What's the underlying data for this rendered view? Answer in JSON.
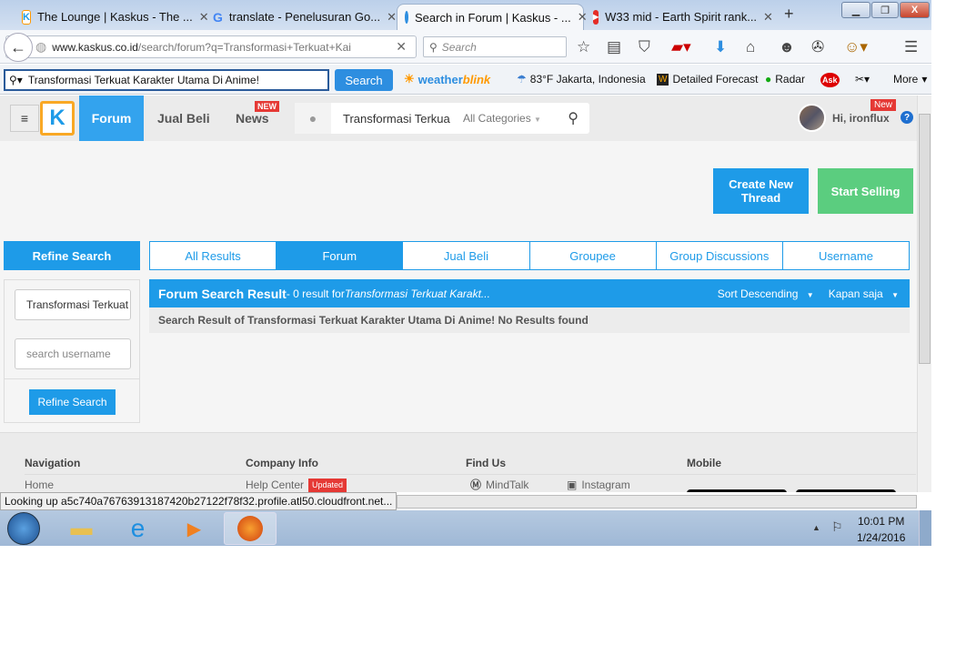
{
  "browser": {
    "tabs": [
      {
        "title": "The Lounge | Kaskus - The ...",
        "icon": "kaskus-icon"
      },
      {
        "title": "translate - Penelusuran Go...",
        "icon": "google-icon"
      },
      {
        "title": "Search in Forum | Kaskus - ...",
        "icon": "loading-icon",
        "active": true
      },
      {
        "title": "W33 mid - Earth Spirit rank...",
        "icon": "youtube-icon"
      }
    ],
    "new_tab": "+",
    "url_domain": "www.kaskus.co.id",
    "url_path": "/search/forum?q=Transformasi+Terkuat+Kai",
    "search_placeholder": "Search",
    "status": "Looking up a5c740a76763913187420b27122f78f32.profile.atl50.cloudfront.net..."
  },
  "toolbar": {
    "search_value": "Transformasi Terkuat Karakter Utama Di Anime!",
    "search_button": "Search",
    "weather_brand": "weather",
    "weather_brand2": "blink",
    "weather": "83°F Jakarta, Indonesia",
    "forecast": "Detailed Forecast",
    "radar": "Radar",
    "more": "More"
  },
  "header": {
    "nav": [
      "Forum",
      "Jual Beli",
      "News"
    ],
    "news_badge": "NEW",
    "search_value": "Transformasi Terkua",
    "category": "All Categories",
    "user": "Hi, ironflux",
    "user_badge": "New",
    "help": "?"
  },
  "actions": {
    "create": "Create New Thread",
    "sell": "Start Selling"
  },
  "refine": {
    "title": "Refine Search",
    "query": "Transformasi Terkuat Karakter Utama Di Anime!",
    "username_placeholder": "search username",
    "button": "Refine Search"
  },
  "search_tabs": [
    "All Results",
    "Forum",
    "Jual Beli",
    "Groupee",
    "Group Discussions",
    "Username"
  ],
  "results": {
    "title": "Forum Search Result",
    "count_text": " - 0 result for ",
    "query": "Transformasi Terkuat Karakt...",
    "sort": "Sort Descending",
    "time": "Kapan saja",
    "message": "Search Result of Transformasi Terkuat Karakter Utama Di Anime! No Results found"
  },
  "footer": {
    "columns": [
      "Navigation",
      "Company Info",
      "Find Us",
      "Mobile"
    ],
    "home": "Home",
    "help_center": "Help Center",
    "updated": "Updated",
    "mindtalk": "MindTalk",
    "instagram": "Instagram"
  },
  "taskbar": {
    "time": "10:01 PM",
    "date": "1/24/2016"
  },
  "colors": {
    "kaskus_blue": "#1e9be8",
    "sell_green": "#5bcd7f",
    "badge_red": "#e53935"
  }
}
